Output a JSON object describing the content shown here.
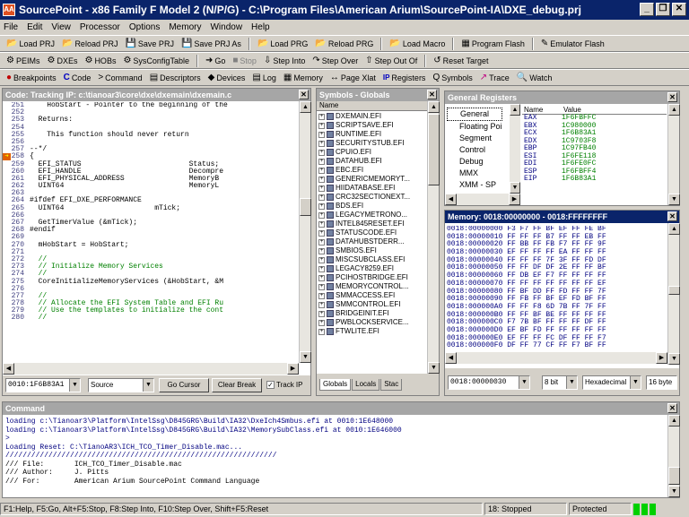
{
  "window": {
    "title": "SourcePoint - x86 Family F Model 2 (N/P/G) - C:\\Program Files\\American Arium\\SourcePoint-IA\\DXE_debug.prj",
    "app_icon": "AA"
  },
  "menu": [
    "File",
    "Edit",
    "View",
    "Processor",
    "Options",
    "Memory",
    "Window",
    "Help"
  ],
  "toolbar1": [
    {
      "icon": "📂",
      "label": "Load PRJ"
    },
    {
      "icon": "📂",
      "label": "Reload PRJ"
    },
    {
      "icon": "💾",
      "label": "Save PRJ"
    },
    {
      "icon": "💾",
      "label": "Save PRJ As"
    },
    {
      "icon": "📂",
      "label": "Load PRG"
    },
    {
      "icon": "📂",
      "label": "Reload PRG"
    },
    {
      "icon": "📂",
      "label": "Load Macro"
    },
    {
      "icon": "▦",
      "label": "Program Flash"
    },
    {
      "icon": "✎",
      "label": "Emulator Flash"
    }
  ],
  "toolbar2": [
    {
      "icon": "⚙",
      "label": "PEIMs"
    },
    {
      "icon": "⚙",
      "label": "DXEs"
    },
    {
      "icon": "⚙",
      "label": "HOBs"
    },
    {
      "icon": "⚙",
      "label": "SysConfigTable"
    },
    {
      "icon": "➜",
      "label": "Go"
    },
    {
      "icon": "■",
      "label": "Stop"
    },
    {
      "icon": "⇩",
      "label": "Step Into"
    },
    {
      "icon": "↷",
      "label": "Step Over"
    },
    {
      "icon": "⇧",
      "label": "Step Out Of"
    },
    {
      "icon": "↺",
      "label": "Reset Target"
    }
  ],
  "toolbar3": [
    {
      "icon": "●",
      "label": "Breakpoints"
    },
    {
      "icon": "C",
      "label": "Code"
    },
    {
      "icon": ">",
      "label": "Command"
    },
    {
      "icon": "▤",
      "label": "Descriptors"
    },
    {
      "icon": "◆",
      "label": "Devices"
    },
    {
      "icon": "▤",
      "label": "Log"
    },
    {
      "icon": "▦",
      "label": "Memory"
    },
    {
      "icon": "↔",
      "label": "Page Xlat"
    },
    {
      "icon": "IP",
      "label": "Registers"
    },
    {
      "icon": "Q",
      "label": "Symbols"
    },
    {
      "icon": "↗",
      "label": "Trace"
    },
    {
      "icon": "🔍",
      "label": "Watch"
    }
  ],
  "code": {
    "title": "Code: Tracking IP: c:\\tianoar3\\core\\dxe\\dxemain\\dxemain.c",
    "lines": [
      {
        "n": "251",
        "t": "    HobStart - Pointer to the beginning of the"
      },
      {
        "n": "252",
        "t": ""
      },
      {
        "n": "253",
        "t": "  Returns:"
      },
      {
        "n": "254",
        "t": ""
      },
      {
        "n": "255",
        "t": "    This function should never return"
      },
      {
        "n": "256",
        "t": ""
      },
      {
        "n": "257",
        "t": "--*/"
      },
      {
        "n": "258",
        "t": "{"
      },
      {
        "n": "259",
        "t": "  EFI_STATUS                         Status;"
      },
      {
        "n": "260",
        "t": "  EFI_HANDLE                         Decompre"
      },
      {
        "n": "261",
        "t": "  EFI_PHYSICAL_ADDRESS               MemoryB"
      },
      {
        "n": "262",
        "t": "  UINT64                             MemoryL"
      },
      {
        "n": "263",
        "t": ""
      },
      {
        "n": "264",
        "t": "#ifdef EFI_DXE_PERFORMANCE"
      },
      {
        "n": "265",
        "t": "  UINT64                     mTick;"
      },
      {
        "n": "266",
        "t": ""
      },
      {
        "n": "267",
        "t": "  GetTimerValue (&mTick);"
      },
      {
        "n": "268",
        "t": "#endif"
      },
      {
        "n": "269",
        "t": ""
      },
      {
        "n": "270",
        "t": "  mHobStart = HobStart;"
      },
      {
        "n": "271",
        "t": ""
      },
      {
        "n": "272",
        "t": "  //"
      },
      {
        "n": "273",
        "t": "  // Initialize Memory Services"
      },
      {
        "n": "274",
        "t": "  //"
      },
      {
        "n": "275",
        "t": "  CoreInitializeMemoryServices (&HobStart, &M"
      },
      {
        "n": "276",
        "t": ""
      },
      {
        "n": "277",
        "t": "  //"
      },
      {
        "n": "278",
        "t": "  // Allocate the EFI System Table and EFI Ru"
      },
      {
        "n": "279",
        "t": "  // Use the templates to initialize the cont"
      },
      {
        "n": "280",
        "t": "  //"
      }
    ],
    "current_line": "258",
    "address": "0010:1F6B83A1",
    "source_mode": "Source",
    "go_cursor": "Go Cursor",
    "clear_break": "Clear Break",
    "track_ip": "Track IP"
  },
  "symbols": {
    "title": "Symbols - Globals",
    "header": "Name",
    "items": [
      "DXEMAIN.EFI",
      "SCRIPTSAVE.EFI",
      "RUNTIME.EFI",
      "SECURITYSTUB.EFI",
      "CPUIO.EFI",
      "DATAHUB.EFI",
      "EBC.EFI",
      "GENERICMEMORYT...",
      "HIIDATABASE.EFI",
      "CRC32SECTIONEXT...",
      "BDS.EFI",
      "LEGACYMETRONO...",
      "INTEL845RESET.EFI",
      "STATUSCODE.EFI",
      "DATAHUBSTDERR...",
      "SMBIOS.EFI",
      "MISCSUBCLASS.EFI",
      "LEGACY8259.EFI",
      "PCIHOSTBRIDGE.EFI",
      "MEMORYCONTROL...",
      "SMMACCESS.EFI",
      "SMMCONTROL.EFI",
      "BRIDGEINIT.EFI",
      "PWBLOCKSERVICE...",
      "FTWLITE.EFI"
    ],
    "tabs": [
      "Globals",
      "Locals",
      "Stac"
    ]
  },
  "registers": {
    "title": "General Registers",
    "tree": [
      "General",
      "Floating Poi",
      "Segment",
      "Control",
      "Debug",
      "MMX",
      "XMM - SP"
    ],
    "col_name": "Name",
    "col_value": "Value",
    "rows": [
      {
        "name": "EAX",
        "value": "1F6FBFFC"
      },
      {
        "name": "EBX",
        "value": "1C980000"
      },
      {
        "name": "ECX",
        "value": "1F6B83A1"
      },
      {
        "name": "EDX",
        "value": "1C9703F8"
      },
      {
        "name": "EBP",
        "value": "1C97FB40"
      },
      {
        "name": "ESI",
        "value": "1F6FE118"
      },
      {
        "name": "EDI",
        "value": "1F6FE0FC"
      },
      {
        "name": "ESP",
        "value": "1F6FBFF4"
      },
      {
        "name": "EIP",
        "value": "1F6B83A1"
      }
    ]
  },
  "memory": {
    "title": "Memory: 0018:00000000 - 0018:FFFFFFFF",
    "rows": [
      "0018:00000000 F3 F7 FF BF EF FF FE BF",
      "0018:00000010 FF FF FF B7 FF FF EB FF",
      "0018:00000020 FF BB FF FB F7 FF FF 9F",
      "0018:00000030 EF FF FF FF EA FF FF FF",
      "0018:00000040 FF FF FF 7F 3F FF FD DF",
      "0018:00000050 FF FF DF DF 2E FF FF BF",
      "0018:00000060 FF DB EF F7 FF FF FF FF",
      "0018:00000070 FF FF FF FF FF FF FF EF",
      "0018:00000080 FF BF DD FF FD FF FF 7F",
      "0018:00000090 FF FB FF BF EF FD BF FF",
      "0018:000000A0 FF FF F8 6D 7B FF 7F FF",
      "0018:000000B0 FF FF BF BE FF FF FF FF",
      "0018:000000C0 F7 7B BF FF FF FF DF FF",
      "0018:000000D0 EF BF FD FF FF FF FF FF",
      "0018:000000E0 EF FF FF FC DF FF FF F7",
      "0018:000000F0 DF FF 77 CF FF F7 BF FF"
    ],
    "address": "0018:00000030",
    "width": "8 bit",
    "format": "Hexadecimal",
    "bytes": "16 byte"
  },
  "command": {
    "title": "Command",
    "lines": [
      "loading c:\\Tianoar3\\Platform\\IntelSsg\\D845GRG\\Build\\IA32\\DxeIch4Smbus.efi at 0010:1E648000",
      "loading c:\\Tianoar3\\Platform\\IntelSsg\\D845GRG\\Build\\IA32\\MemorySubClass.efi at 0010:1E646000",
      ">",
      "Loading Reset: C:\\TianoAR3\\ICH_TCO_Timer_Disable.mac...",
      "///////////////////////////////////////////////////////////////",
      "/// File:       ICH_TCO_Timer_Disable.mac",
      "/// Author:     J. Pitts",
      "/// For:        American Arium SourcePoint Command Language"
    ]
  },
  "status": {
    "help": "F1:Help, F5:Go, Alt+F5:Stop, F8:Step Into, F10:Step Over, Shift+F5:Reset",
    "state": "18: Stopped",
    "mode": "Protected"
  }
}
